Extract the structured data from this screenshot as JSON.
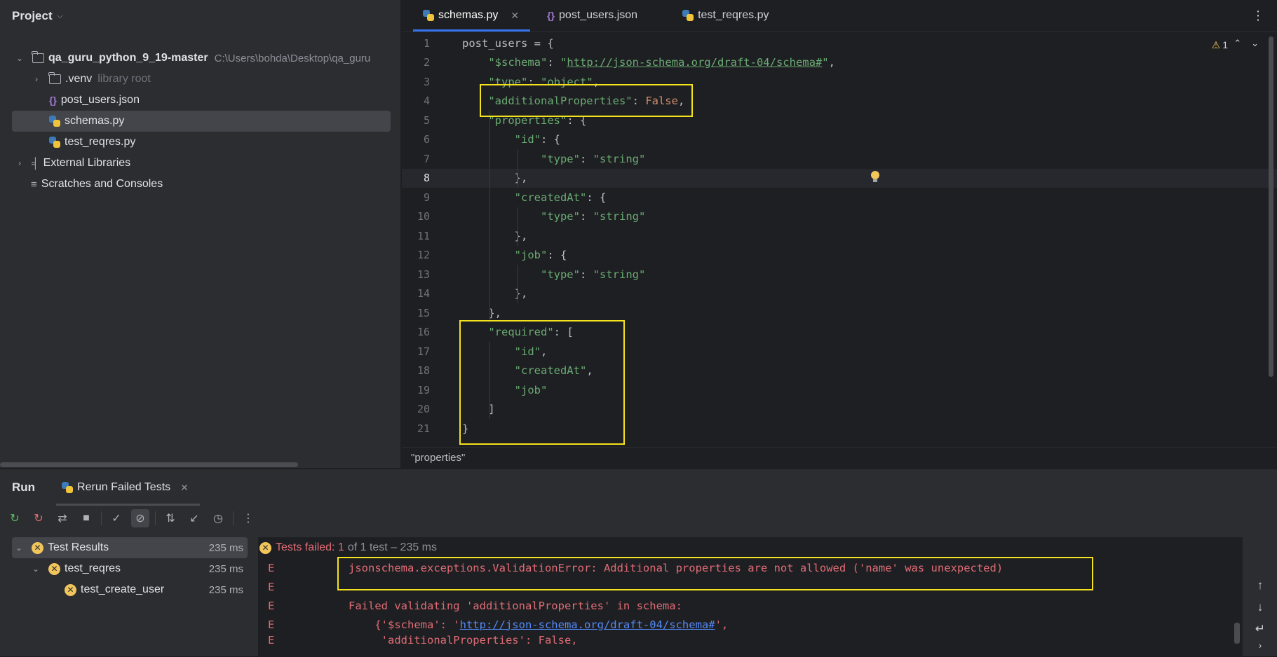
{
  "project": {
    "title": "Project",
    "tree": [
      {
        "label": "qa_guru_python_9_19-master",
        "path": "C:\\Users\\bohda\\Desktop\\qa_guru"
      },
      {
        "label": ".venv",
        "note": "library root"
      },
      {
        "label": "post_users.json"
      },
      {
        "label": "schemas.py"
      },
      {
        "label": "test_reqres.py"
      },
      {
        "label": "External Libraries"
      },
      {
        "label": "Scratches and Consoles"
      }
    ]
  },
  "editor": {
    "tabs": [
      {
        "label": "schemas.py"
      },
      {
        "label": "post_users.json"
      },
      {
        "label": "test_reqres.py"
      }
    ],
    "warnings_count": "1",
    "breadcrumb": "\"properties\"",
    "lines": [
      "post_users = {",
      "    \"$schema\": \"http://json-schema.org/draft-04/schema#\",",
      "    \"type\": \"object\",",
      "    \"additionalProperties\": False,",
      "    \"properties\": {",
      "        \"id\": {",
      "            \"type\": \"string\"",
      "        },",
      "        \"createdAt\": {",
      "            \"type\": \"string\"",
      "        },",
      "        \"job\": {",
      "            \"type\": \"string\"",
      "        },",
      "    },",
      "    \"required\": [",
      "        \"id\",",
      "        \"createdAt\",",
      "        \"job\"",
      "    ]",
      "}"
    ]
  },
  "run": {
    "title": "Run",
    "tab_label": "Rerun Failed Tests",
    "results": [
      {
        "label": "Test Results",
        "ms": "235 ms"
      },
      {
        "label": "test_reqres",
        "ms": "235 ms"
      },
      {
        "label": "test_create_user",
        "ms": "235 ms"
      }
    ],
    "status_main": "Tests failed: 1",
    "status_rest": "of 1 test – 235 ms",
    "console": [
      {
        "marker": "E",
        "text": "jsonschema.exceptions.ValidationError: Additional properties are not allowed ('name' was unexpected)"
      },
      {
        "marker": "E",
        "text": ""
      },
      {
        "marker": "E",
        "text": "Failed validating 'additionalProperties' in schema:"
      },
      {
        "marker": "E",
        "pre": "    {'$schema': '",
        "link": "http://json-schema.org/draft-04/schema#",
        "post": "',"
      },
      {
        "marker": "E",
        "text": "     'additionalProperties': False,"
      }
    ]
  }
}
